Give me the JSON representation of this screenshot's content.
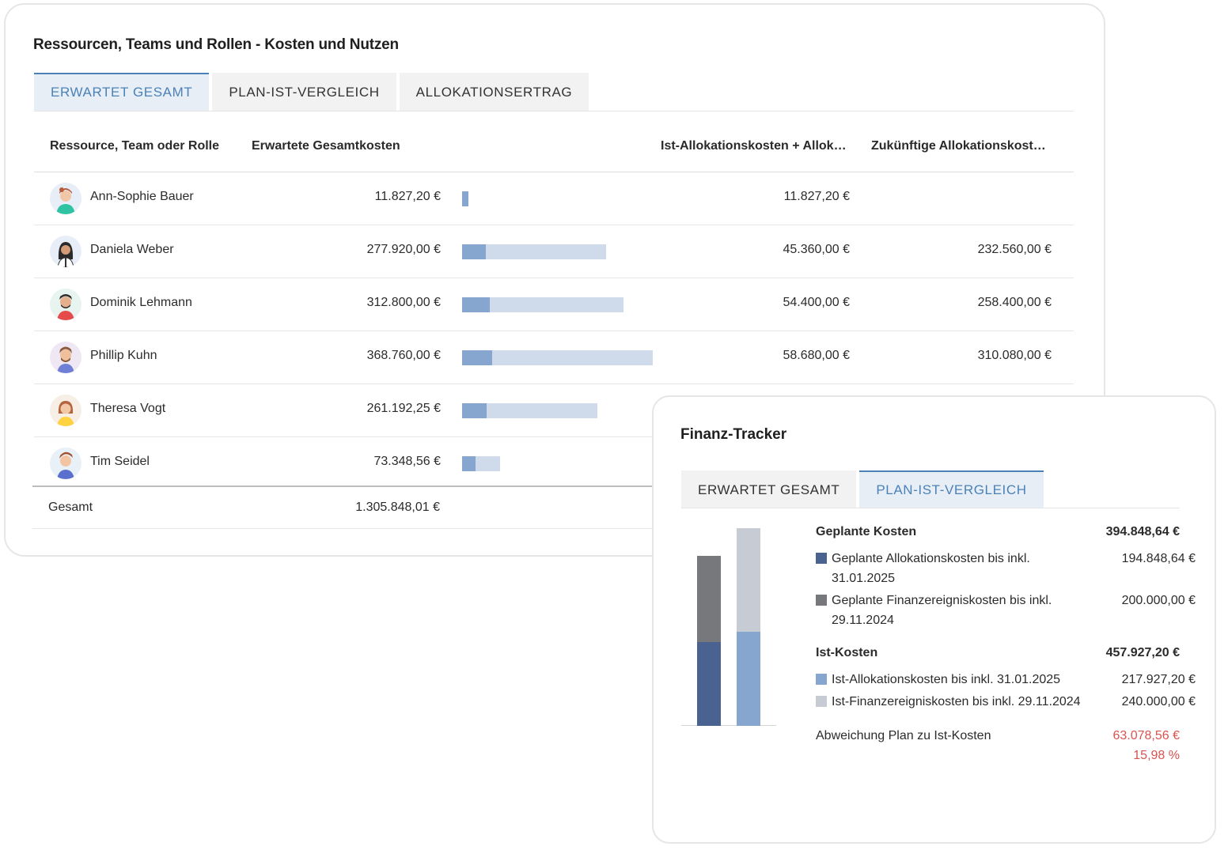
{
  "main": {
    "title": "Ressourcen, Teams und Rollen - Kosten und Nutzen",
    "tabs": [
      {
        "label": "ERWARTET GESAMT",
        "active": true
      },
      {
        "label": "PLAN-IST-VERGLEICH",
        "active": false
      },
      {
        "label": "ALLOKATIONSERTRAG",
        "active": false
      }
    ],
    "columns": {
      "resource": "Ressource, Team oder Rolle",
      "expected_total": "Erwartete Gesamtkosten",
      "actual_alloc": "Ist-Allokationskosten + Allok…",
      "future_alloc": "Zukünftige Allokationskost…"
    },
    "rows": [
      {
        "name": "Ann-Sophie Bauer",
        "total": "11.827,20 €",
        "ist": "11.827,20 €",
        "future": "",
        "bar_share": 0.032,
        "bar_ist_share": 1.0
      },
      {
        "name": "Daniela Weber",
        "total": "277.920,00 €",
        "ist": "45.360,00 €",
        "future": "232.560,00 €",
        "bar_share": 0.754,
        "bar_ist_share": 0.163
      },
      {
        "name": "Dominik Lehmann",
        "total": "312.800,00 €",
        "ist": "54.400,00 €",
        "future": "258.400,00 €",
        "bar_share": 0.848,
        "bar_ist_share": 0.174
      },
      {
        "name": "Phillip Kuhn",
        "total": "368.760,00 €",
        "ist": "58.680,00 €",
        "future": "310.080,00 €",
        "bar_share": 1.0,
        "bar_ist_share": 0.159
      },
      {
        "name": "Theresa Vogt",
        "total": "261.192,25 €",
        "ist": "",
        "future": "",
        "bar_share": 0.708,
        "bar_ist_share": 0.18
      },
      {
        "name": "Tim Seidel",
        "total": "73.348,56 €",
        "ist": "",
        "future": "",
        "bar_share": 0.199,
        "bar_ist_share": 0.35
      }
    ],
    "total_label": "Gesamt",
    "total_value": "1.305.848,01 €",
    "colors": {
      "bar_bg": "#cfdaea",
      "bar_fg": "#86a6cf",
      "accent": "#4a82b8"
    }
  },
  "finance": {
    "title": "Finanz-Tracker",
    "tabs": [
      {
        "label": "ERWARTET GESAMT",
        "active": false
      },
      {
        "label": "PLAN-IST-VERGLEICH",
        "active": true
      }
    ],
    "planned": {
      "label": "Geplante Kosten",
      "amount": "394.848,64 €",
      "items": [
        {
          "label": "Geplante Allokationskosten bis inkl. 31.01.2025",
          "amount": "194.848,64 €",
          "color": "#4a628f"
        },
        {
          "label": "Geplante Finanzereigniskosten bis inkl. 29.11.2024",
          "amount": "200.000,00 €",
          "color": "#76787c"
        }
      ]
    },
    "actual": {
      "label": "Ist-Kosten",
      "amount": "457.927,20 €",
      "items": [
        {
          "label": "Ist-Allokationskosten bis inkl. 31.01.2025",
          "amount": "217.927,20 €",
          "color": "#86a6cf"
        },
        {
          "label": "Ist-Finanzereigniskosten bis inkl. 29.11.2024",
          "amount": "240.000,00 €",
          "color": "#c7ccd4"
        }
      ]
    },
    "deviation": {
      "label": "Abweichung Plan zu Ist-Kosten",
      "amount": "63.078,56 €",
      "percent": "15,98 %"
    },
    "chart_data": {
      "type": "bar",
      "stacked": true,
      "categories": [
        "",
        ""
      ],
      "series": [
        {
          "name": "Geplante Allokationskosten bis inkl. 31.01.2025",
          "values": [
            194848.64,
            0
          ],
          "color": "#4a628f"
        },
        {
          "name": "Geplante Finanzereigniskosten bis inkl. 29.11.2024",
          "values": [
            200000.0,
            0
          ],
          "color": "#76787c"
        },
        {
          "name": "Ist-Allokationskosten bis inkl. 31.01.2025",
          "values": [
            0,
            217927.2
          ],
          "color": "#86a6cf"
        },
        {
          "name": "Ist-Finanzereigniskosten bis inkl. 29.11.2024",
          "values": [
            0,
            240000.0
          ],
          "color": "#c7ccd4"
        }
      ],
      "ylim": [
        0,
        457927.2
      ]
    }
  }
}
